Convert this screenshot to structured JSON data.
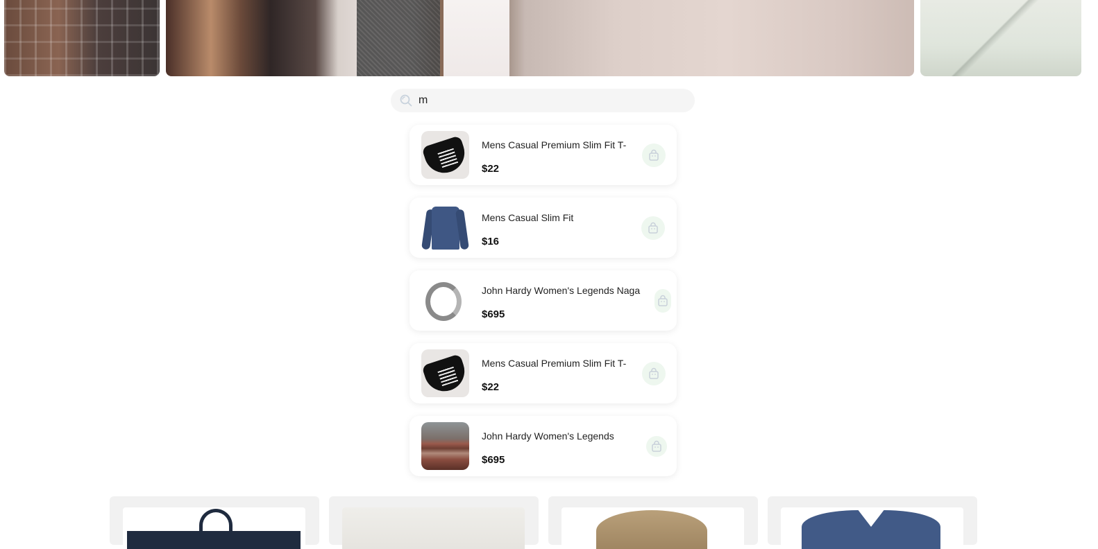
{
  "search": {
    "value": "m",
    "icon": "search-icon"
  },
  "results": [
    {
      "title": "Mens Casual Premium Slim Fit T-Shirts",
      "price": "$22",
      "image": "black-tshirt"
    },
    {
      "title": "Mens Casual Slim Fit",
      "price": "$16",
      "image": "blue-longsleeve"
    },
    {
      "title": "John Hardy Women's Legends Naga Gold & Silver Dragon Station Chain Bracelet",
      "price": "$695",
      "image": "silver-bracelet"
    },
    {
      "title": "Mens Casual Premium Slim Fit T-Shirts",
      "price": "$22",
      "image": "black-tshirt"
    },
    {
      "title": "John Hardy Women's Legends Naga Gold",
      "price": "$695",
      "image": "folded-clothes"
    }
  ],
  "colors": {
    "cart_button_bg": "#eef7ef",
    "search_bg": "#f5f5f5",
    "card_bg": "#f1f1f1"
  }
}
